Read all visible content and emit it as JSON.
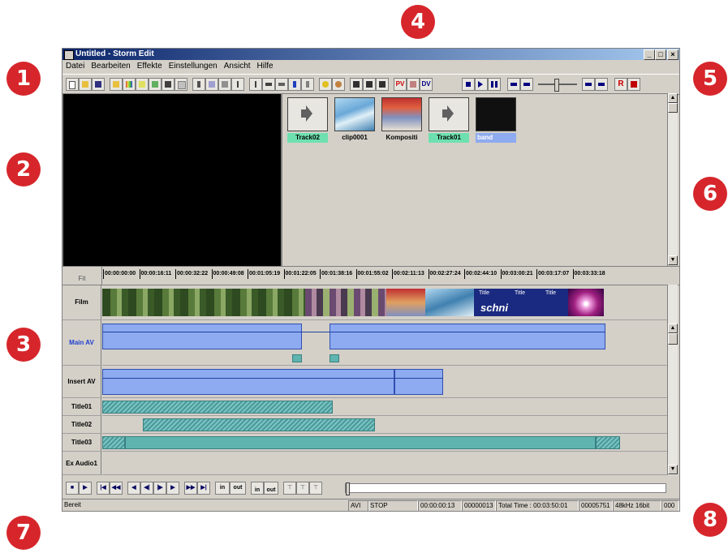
{
  "window": {
    "title": "Untitled - Storm Edit"
  },
  "menu": [
    "Datei",
    "Bearbeiten",
    "Effekte",
    "Einstellungen",
    "Ansicht",
    "Hilfe"
  ],
  "toolbar": {
    "pv": "PV",
    "dv": "DV",
    "r": "R"
  },
  "clips": [
    {
      "label": "Track02",
      "kind": "audio",
      "color": "#6ee0b0"
    },
    {
      "label": "clip0001",
      "kind": "video",
      "color": "#d4d0c8"
    },
    {
      "label": "Kompositi",
      "kind": "video",
      "color": "#d4d0c8"
    },
    {
      "label": "Track01",
      "kind": "audio",
      "color": "#6ee0b0"
    },
    {
      "label": "band",
      "kind": "black",
      "color": "#8eaaf0"
    }
  ],
  "ruler": {
    "fit": "Fit",
    "ticks": [
      "00:00:00:00",
      "00:00:16:11",
      "00:00:32:22",
      "00:00:49:08",
      "00:01:05:19",
      "00:01:22:05",
      "00:01:38:16",
      "00:01:55:02",
      "00:02:11:13",
      "00:02:27:24",
      "00:02:44:10",
      "00:03:00:21",
      "00:03:17:07",
      "00:03:33:18"
    ]
  },
  "tracks": {
    "film": "Film",
    "main_av": "Main AV",
    "insert_av": "Insert AV",
    "title01": "Title01",
    "title02": "Title02",
    "title03": "Title03",
    "ex_audio1": "Ex Audio1"
  },
  "film_text": {
    "title": "Title",
    "schnitt": "schni"
  },
  "transport": {
    "in": "in",
    "out": "out"
  },
  "status": {
    "ready": "Bereit",
    "format": "AVI",
    "state": "STOP",
    "timecode": "00:00:00:13",
    "frame": "00000013",
    "total": "Total Time : 00:03:50:01",
    "frames": "00005751",
    "audio": "48kHz 16bit",
    "extra": "000"
  },
  "colors": {
    "badge": "#d6262b",
    "track_blue": "#8eaaf0",
    "track_teal": "#5fb4b0"
  },
  "badges": [
    "1",
    "2",
    "3",
    "4",
    "5",
    "6",
    "7",
    "8"
  ]
}
